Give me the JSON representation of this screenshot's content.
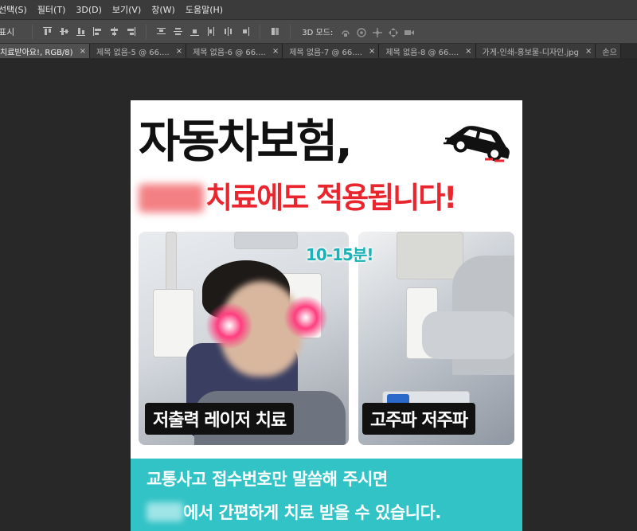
{
  "menu": {
    "items": [
      "선택(S)",
      "필터(T)",
      "3D(D)",
      "보기(V)",
      "창(W)",
      "도움말(H)"
    ]
  },
  "options_bar": {
    "show_label": "표시",
    "mode3d_label": "3D 모드:"
  },
  "tabs": [
    {
      "label": "치료받아요!, RGB/8)",
      "active": true
    },
    {
      "label": "제목 없음-5 @ 66....",
      "active": false
    },
    {
      "label": "제목 없음-6 @ 66....",
      "active": false
    },
    {
      "label": "제목 없음-7 @ 66....",
      "active": false
    },
    {
      "label": "제목 없음-8 @ 66....",
      "active": false
    },
    {
      "label": "가게-인쇄-홍보물-디자인.jpg",
      "active": false
    },
    {
      "label": "손으",
      "active": false
    }
  ],
  "tab_close_glyph": "×",
  "document": {
    "headline": "자동차보험,",
    "subheadline": "치료에도 적용됩니다!",
    "badge": "10-15분!",
    "caption_left": "저출력 레이저 치료",
    "caption_right": "고주파 저주파",
    "band_line1": "교통사고 접수번호만 말씀해 주시면",
    "band_line2": "에서 간편하게 치료 받을 수 있습니다.",
    "colors": {
      "accent_red": "#e9252e",
      "accent_teal": "#32c3c6",
      "badge_teal": "#1ab2b7"
    }
  }
}
